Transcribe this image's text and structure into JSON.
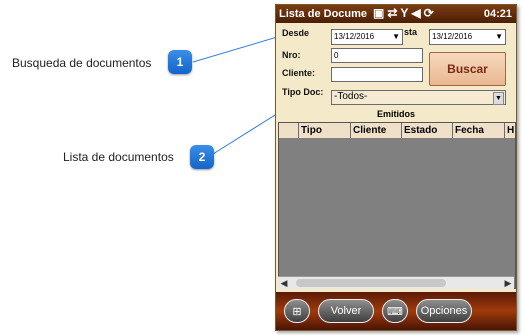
{
  "callouts": [
    {
      "label": "Busqueda de documentos",
      "number": "1"
    },
    {
      "label": "Lista de documentos",
      "number": "2"
    }
  ],
  "titlebar": {
    "title": "Lista de Docume",
    "icons": [
      "message-icon",
      "signal-sync-icon",
      "no-signal-icon",
      "volume-mute-icon",
      "sync-icon"
    ],
    "time": "04:21"
  },
  "form": {
    "desde_label": "Desde",
    "hasta_label": "sta",
    "desde_value": "13/12/2016",
    "hasta_value": "13/12/2016",
    "nro_label": "Nro:",
    "nro_value": "0",
    "cliente_label": "Cliente:",
    "cliente_value": "",
    "tipo_label": "Tipo Doc:",
    "tipo_value": "-Todos-",
    "buscar_label": "Buscar"
  },
  "list": {
    "title": "Emitidos",
    "columns": [
      "",
      "Tipo",
      "Cliente",
      "Estado",
      "Fecha",
      "H"
    ]
  },
  "softkeys": {
    "volver": "Volver",
    "opciones": "Opciones"
  },
  "colors": {
    "badge": "#1f73d8",
    "titlebar": "#5c2808",
    "panel": "#f4e9c8",
    "grid_body": "#808080"
  }
}
